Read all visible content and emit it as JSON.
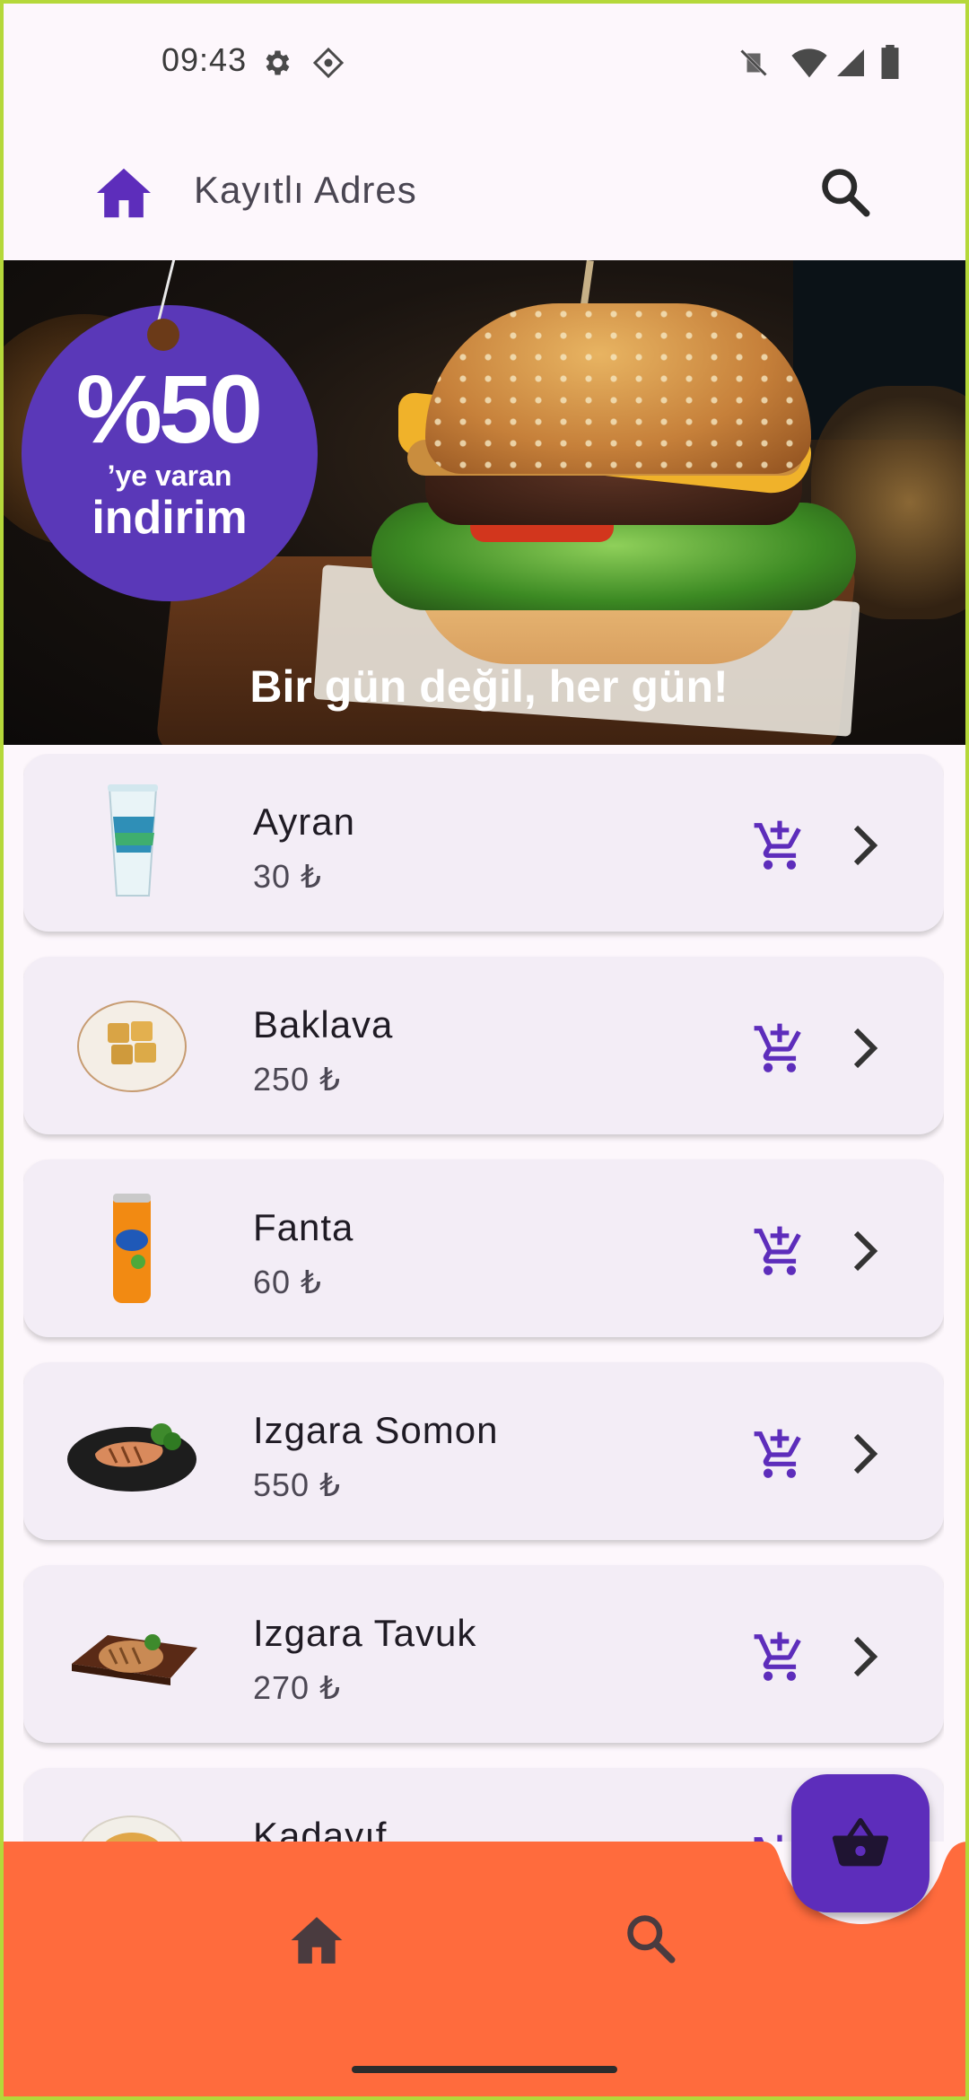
{
  "status_bar": {
    "time": "09:43"
  },
  "app_bar": {
    "title": "Kayıtlı Adres"
  },
  "banner": {
    "discount_value": "%50",
    "discount_suffix": "’ye varan",
    "discount_word": "indirim",
    "slogan": "Bir gün değil, her gün!"
  },
  "products": [
    {
      "name": "Ayran",
      "price": "30 ₺",
      "image": "ayran-cup"
    },
    {
      "name": "Baklava",
      "price": "250 ₺",
      "image": "baklava-plate"
    },
    {
      "name": "Fanta",
      "price": "60 ₺",
      "image": "fanta-can"
    },
    {
      "name": "Izgara Somon",
      "price": "550 ₺",
      "image": "grilled-salmon"
    },
    {
      "name": "Izgara Tavuk",
      "price": "270 ₺",
      "image": "grilled-chicken"
    },
    {
      "name": "Kadayıf",
      "price": "",
      "image": "kadayif"
    }
  ],
  "colors": {
    "accent": "#5d2dbb",
    "bottom_nav": "#ff6b3d",
    "card": "#f3edf6",
    "background": "#fdf7fc"
  },
  "icons": {
    "app_bar_home": "home-icon",
    "app_bar_search": "search-icon",
    "add_to_cart": "add-shopping-cart-icon",
    "details": "chevron-right-icon",
    "fab": "shopping-basket-icon",
    "nav_home": "home-icon",
    "nav_search": "search-icon"
  }
}
